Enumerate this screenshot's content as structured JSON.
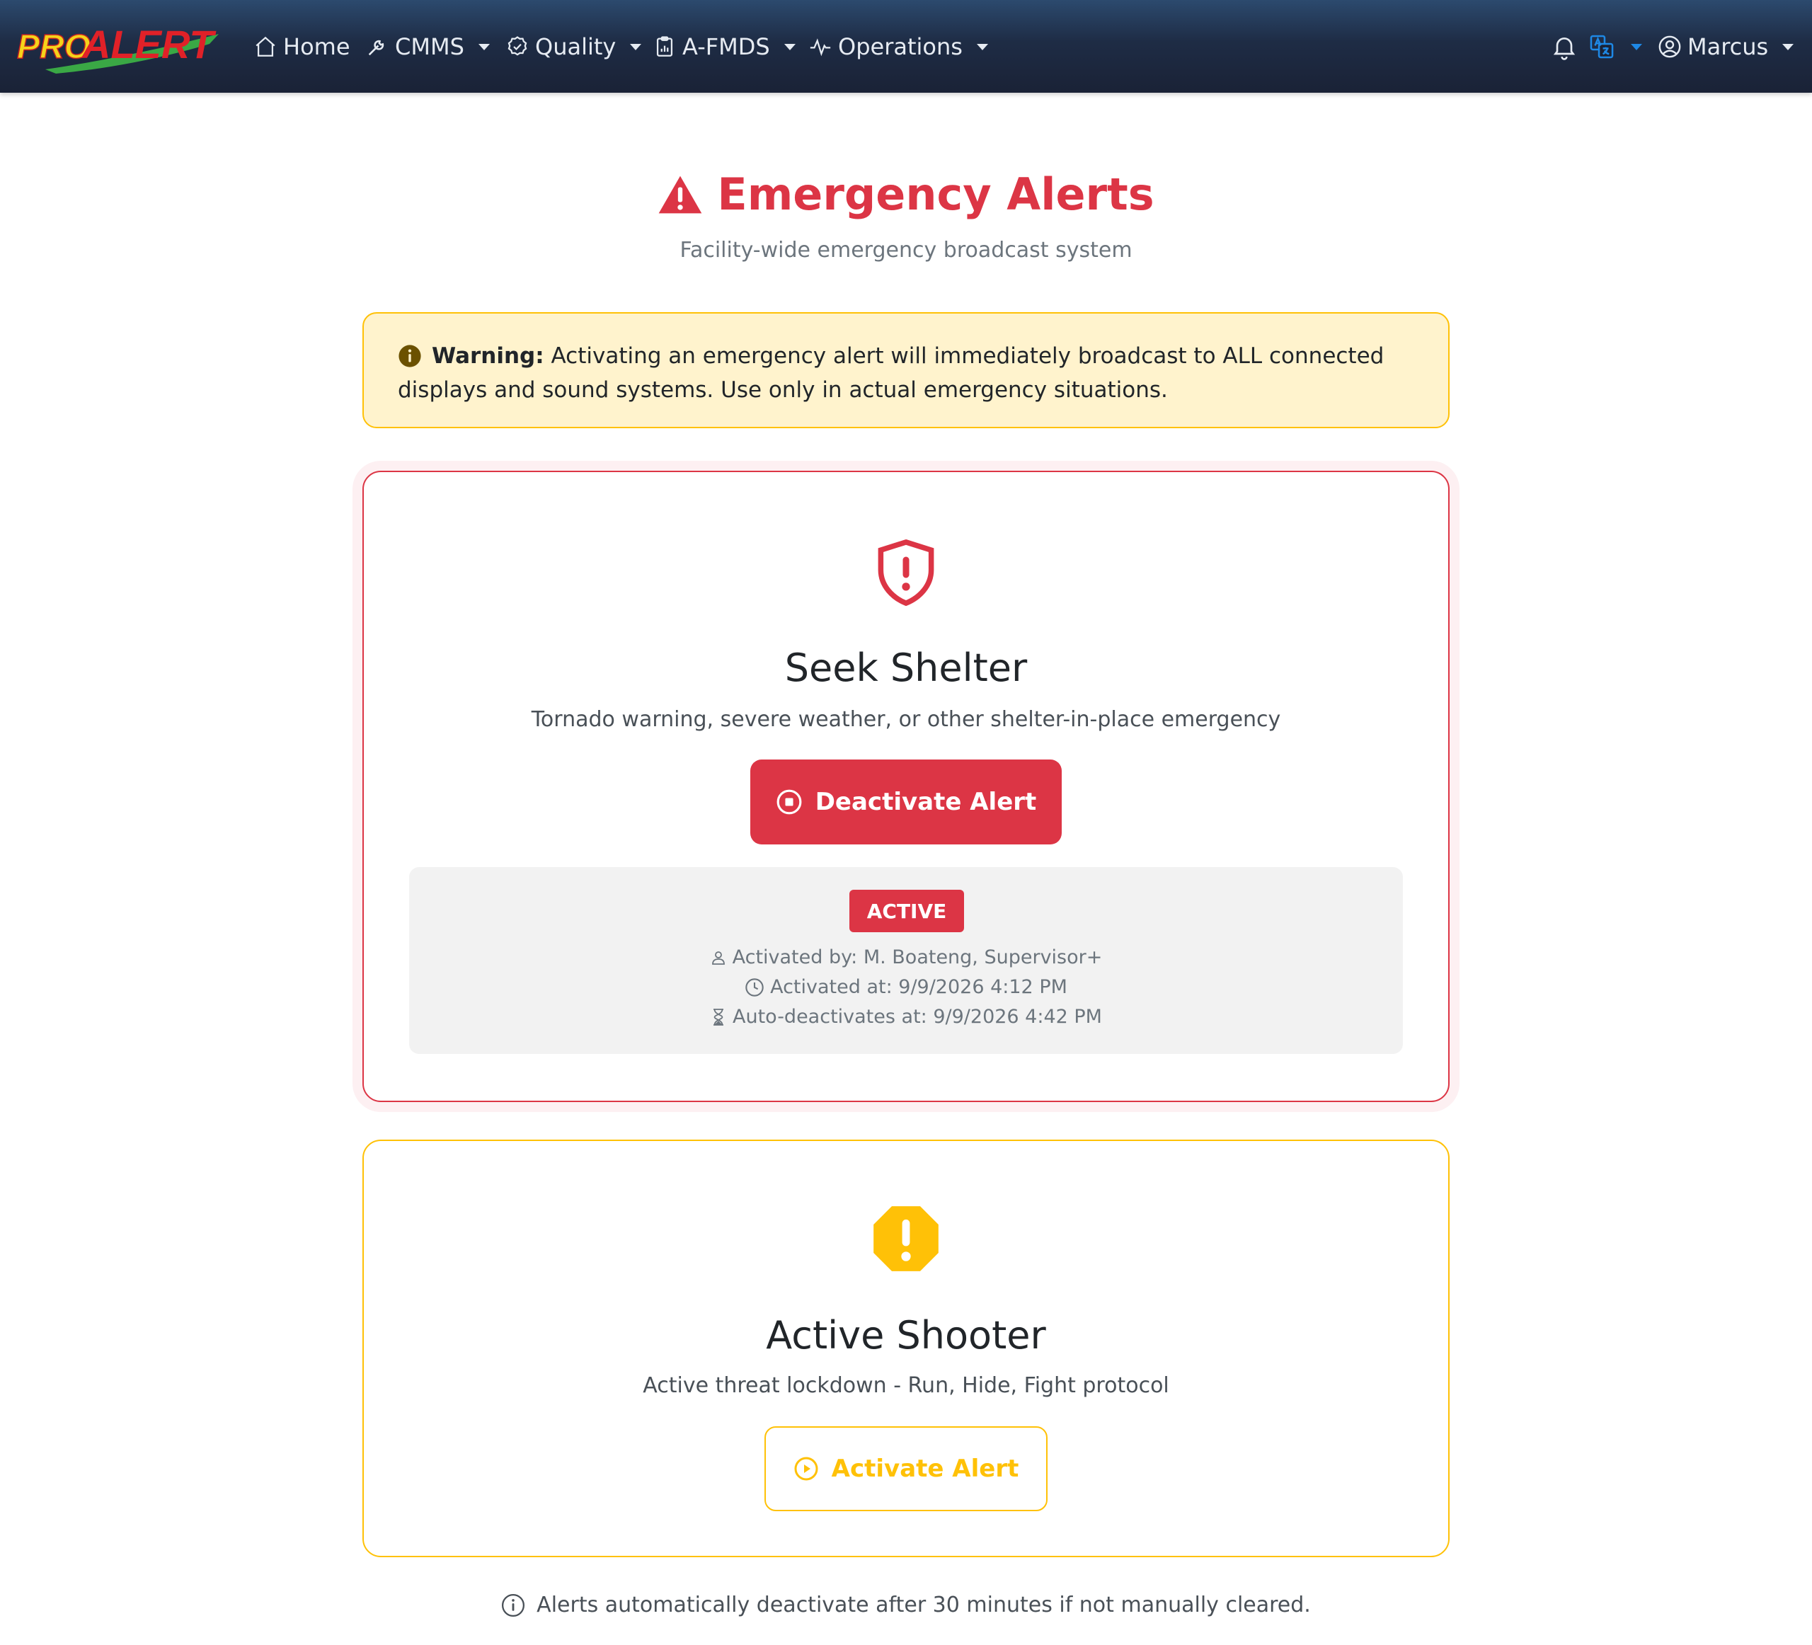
{
  "nav": {
    "logo_text": "PROALERT",
    "items": [
      {
        "label": "Home",
        "icon": "home-icon"
      },
      {
        "label": "CMMS",
        "icon": "wrench-icon"
      },
      {
        "label": "Quality",
        "icon": "badge-check-icon"
      },
      {
        "label": "A-FMDS",
        "icon": "clipboard-chart-icon"
      },
      {
        "label": "Operations",
        "icon": "pulse-icon"
      }
    ],
    "user_name": "Marcus"
  },
  "header": {
    "title": "Emergency Alerts",
    "subtitle": "Facility-wide emergency broadcast system"
  },
  "warning": {
    "label": "Warning:",
    "text": "Activating an emergency alert will immediately broadcast to ALL connected displays and sound systems. Use only in actual emergency situations."
  },
  "alerts": [
    {
      "title": "Seek Shelter",
      "description": "Tornado warning, severe weather, or other shelter-in-place emergency",
      "button_label": "Deactivate Alert",
      "status_badge": "ACTIVE",
      "activated_by": "Activated by: M. Boateng, Supervisor+",
      "activated_at": "Activated at: 9/9/2026 4:12 PM",
      "auto_deactivates_at": "Auto-deactivates at: 9/9/2026 4:42 PM"
    },
    {
      "title": "Active Shooter",
      "description": "Active threat lockdown - Run, Hide, Fight protocol",
      "button_label": "Activate Alert"
    }
  ],
  "footer_note": "Alerts automatically deactivate after 30 minutes if not manually cleared.",
  "colors": {
    "danger": "#dc3545",
    "warning": "#ffc107",
    "navbar": "#1e2c45",
    "accent_blue": "#1e88e5"
  }
}
